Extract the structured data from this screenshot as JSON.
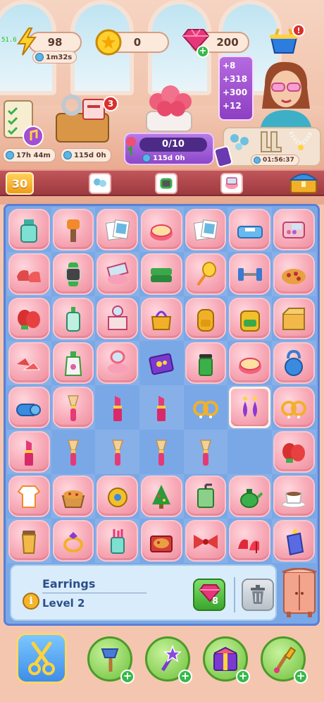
{
  "debug": {
    "fps": "51.6"
  },
  "hud": {
    "energy": {
      "value": "98",
      "timer": "1m32s"
    },
    "coins": {
      "value": "0"
    },
    "gems": {
      "value": "200"
    },
    "shop_badge": "!"
  },
  "quest": {
    "badge": "3",
    "timer_left": "17h 44m",
    "timer_mid": "115d 0h"
  },
  "order": {
    "progress": "0/10",
    "timer": "115d 0h",
    "progress_fraction": 0.0
  },
  "rewards": {
    "items": [
      "+8",
      "+318",
      "+300",
      "+12"
    ]
  },
  "event": {
    "timer": "01:56:37"
  },
  "level": {
    "number": "30"
  },
  "board": {
    "rows": [
      [
        "mouthwash-icon",
        "lint-roller-icon",
        "photos-icon",
        "powder-compact-icon",
        "photos-icon",
        "bathroom-scale-icon",
        "makeup-palette-icon"
      ],
      [
        "clogs-icon",
        "smartwatch-icon",
        "mirror-compact-icon",
        "towels-icon",
        "hand-mirror-icon",
        "dumbbells-icon",
        "pizza-icon"
      ],
      [
        "boxing-gloves-icon",
        "lotion-bottle-icon",
        "vanity-table-icon",
        "handbag-icon",
        "backpack-icon",
        "school-bag-icon",
        "cardboard-box-icon"
      ],
      [
        "sneakers-icon",
        "perfume-bottle-icon",
        "compact-powder-icon",
        "jewelry-box-icon",
        "thermos-cup-icon",
        "powder-compact-icon",
        "kettlebell-icon"
      ],
      [
        "yoga-mat-icon",
        "makeup-brush-icon",
        "lipstick-icon",
        "lipstick-icon",
        "hoop-earrings-icon",
        "drop-earrings-icon",
        "hoop-earrings-icon"
      ],
      [
        "lipstick-icon",
        "makeup-brush-icon",
        "makeup-brush-icon",
        "makeup-brush-icon",
        "makeup-brush-icon",
        "",
        "boxing-gloves-icon"
      ],
      [
        "baby-onesie-icon",
        "pizza-basket-icon",
        "measuring-tape-icon",
        "christmas-tree-icon",
        "coffee-grinder-icon",
        "green-teapot-icon",
        "coffee-cup-icon"
      ],
      [
        "takeaway-cup-icon",
        "gold-ring-icon",
        "brush-cup-icon",
        "pizza-box-icon",
        "red-bow-icon",
        "red-heels-icon",
        "blue-perfume-icon"
      ]
    ],
    "bubbled": [
      [
        1,
        1,
        1,
        1,
        1,
        1,
        1
      ],
      [
        1,
        1,
        1,
        1,
        1,
        1,
        1
      ],
      [
        1,
        1,
        1,
        1,
        1,
        1,
        1
      ],
      [
        1,
        1,
        1,
        0,
        1,
        1,
        1
      ],
      [
        1,
        1,
        0,
        0,
        0,
        1,
        1
      ],
      [
        1,
        0,
        0,
        0,
        0,
        0,
        1
      ],
      [
        1,
        1,
        1,
        1,
        1,
        1,
        1
      ],
      [
        1,
        1,
        1,
        1,
        1,
        1,
        1
      ]
    ],
    "selected_cell": [
      4,
      5
    ]
  },
  "info": {
    "item_name": "Earrings",
    "item_level": "Level 2",
    "sell_value": "8"
  },
  "tools": [
    "scissors-icon",
    "axe-icon",
    "magic-wand-icon",
    "mystery-box-icon",
    "paint-brush-icon"
  ],
  "colors": {
    "board_bg": "#7aa8e6",
    "bubble_pink": "#f7a9b6",
    "accent_green": "#38b84a",
    "badge_red": "#d9302c"
  }
}
